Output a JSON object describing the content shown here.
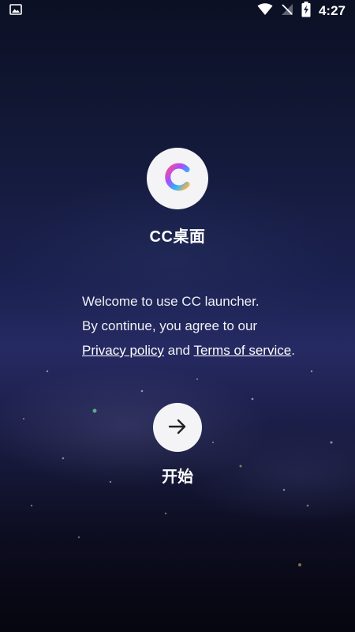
{
  "status_bar": {
    "time": "4:27",
    "icons": [
      "image-icon",
      "wifi-icon",
      "no-signal-icon",
      "battery-charging-icon"
    ]
  },
  "app": {
    "name": "CC桌面",
    "logo_icon": "cc-logo-icon"
  },
  "welcome": {
    "line1": "Welcome to use CC launcher.",
    "line2": "By continue, you agree to our",
    "privacy_link": "Privacy policy",
    "and_text": " and ",
    "terms_link": "Terms of service",
    "period": "."
  },
  "start": {
    "label": "开始",
    "button_icon": "arrow-right-icon"
  },
  "colors": {
    "logo_gradient": [
      "#ff4f8b",
      "#a64dff",
      "#2bb6ff",
      "#ffb347"
    ],
    "button_bg": "#f4f4f6",
    "text": "#ffffff"
  }
}
